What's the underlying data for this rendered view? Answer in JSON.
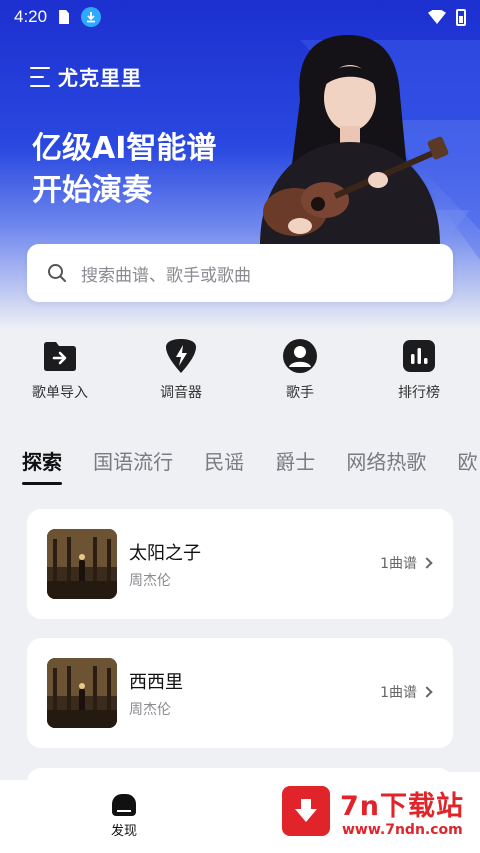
{
  "status_bar": {
    "time": "4:20"
  },
  "brand": {
    "name": "尤克里里"
  },
  "hero": {
    "slogan_line1": "亿级AI智能谱",
    "slogan_line2": "开始演奏"
  },
  "search": {
    "placeholder": "搜索曲谱、歌手或歌曲"
  },
  "quick_actions": [
    {
      "label": "歌单导入",
      "icon": "folder-arrow-icon"
    },
    {
      "label": "调音器",
      "icon": "guitar-pick-bolt-icon"
    },
    {
      "label": "歌手",
      "icon": "person-icon"
    },
    {
      "label": "排行榜",
      "icon": "bar-chart-icon"
    }
  ],
  "tabs": [
    "探索",
    "国语流行",
    "民谣",
    "爵士",
    "网络热歌",
    "欧"
  ],
  "songs": [
    {
      "title": "太阳之子",
      "artist": "周杰伦",
      "count": "1曲谱"
    },
    {
      "title": "西西里",
      "artist": "周杰伦",
      "count": "1曲谱"
    }
  ],
  "bottom_nav": {
    "label": "发现"
  },
  "watermark": {
    "brand": "7n下载站",
    "url": "www.7ndn.com"
  },
  "colors": {
    "hero_blue": "#1c2fd0",
    "watermark_red": "#e0242a"
  }
}
